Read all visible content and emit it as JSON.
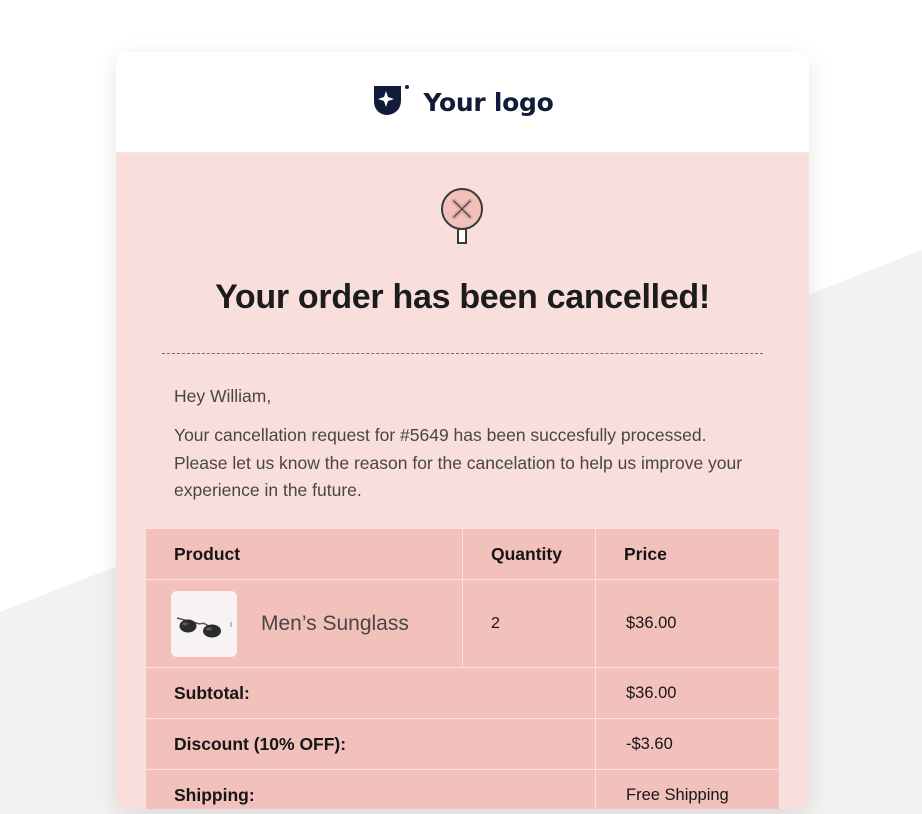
{
  "brand": {
    "logo_text": "Your logo",
    "logo_color": "#111b3a"
  },
  "email": {
    "title": "Your order has been cancelled!",
    "greeting": "Hey William,",
    "message": "Your cancellation request for #5649 has been succesfully processed. Please let us know the reason for the cancelation to help us improve your experience in the future."
  },
  "order_table": {
    "headers": {
      "product": "Product",
      "quantity": "Quantity",
      "price": "Price"
    },
    "items": [
      {
        "name": "Men’s Sunglass",
        "quantity": "2",
        "price": "$36.00",
        "image_icon": "sunglasses-icon"
      }
    ],
    "summary": [
      {
        "label": "Subtotal:",
        "value": "$36.00"
      },
      {
        "label": "Discount (10% OFF):",
        "value": "-$3.60"
      },
      {
        "label": "Shipping:",
        "value": "Free Shipping"
      }
    ]
  },
  "colors": {
    "card_background": "#f9dfdb",
    "table_cell": "#f2c1bb",
    "text_dark": "#1c1c1e",
    "text_body": "#4a4545"
  }
}
